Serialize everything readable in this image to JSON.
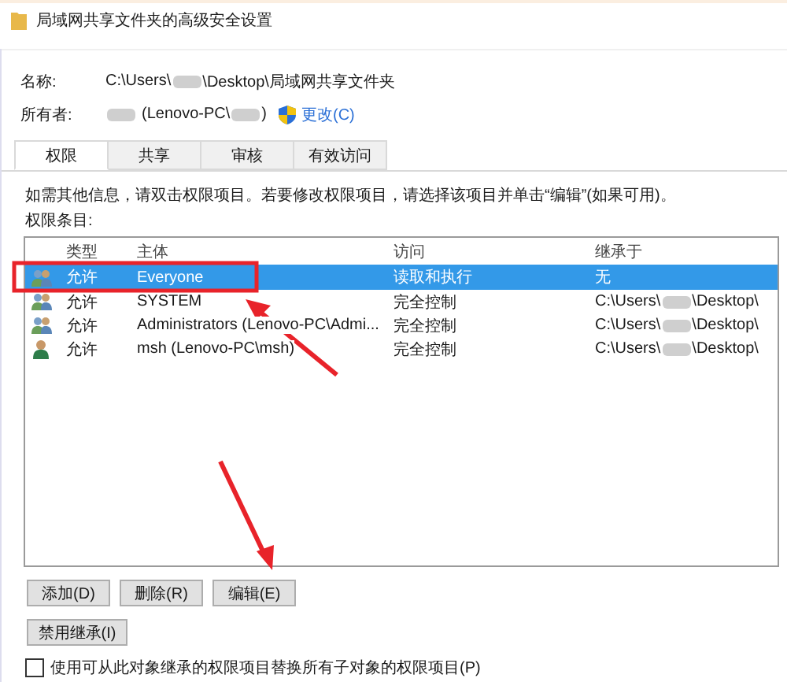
{
  "window": {
    "title": "局域网共享文件夹的高级安全设置"
  },
  "name_field": {
    "label": "名称:",
    "path_before": "C:\\Users\\",
    "path_after": "\\Desktop\\局域网共享文件夹"
  },
  "owner_field": {
    "label": "所有者:",
    "value_before": "(Lenovo-PC\\",
    "value_after": ")",
    "change_link": "更改(C)"
  },
  "tabs": [
    {
      "label": "权限",
      "selected": true
    },
    {
      "label": "共享",
      "selected": false
    },
    {
      "label": "审核",
      "selected": false
    },
    {
      "label": "有效访问",
      "selected": false
    }
  ],
  "info_text": "如需其他信息，请双击权限项目。若要修改权限项目，请选择该项目并单击“编辑”(如果可用)。",
  "entries_label": "权限条目:",
  "table": {
    "columns": [
      "类型",
      "主体",
      "访问",
      "继承于"
    ],
    "rows": [
      {
        "kind": "group",
        "type": "允许",
        "principal": "Everyone",
        "access": "读取和执行",
        "inherited_before": "无",
        "selected": true
      },
      {
        "kind": "group",
        "type": "允许",
        "principal": "SYSTEM",
        "access": "完全控制",
        "inherited_before": "C:\\Users\\",
        "inherited_after": "\\Desktop\\",
        "selected": false
      },
      {
        "kind": "group",
        "type": "允许",
        "principal": "Administrators (Lenovo-PC\\Admi...",
        "access": "完全控制",
        "inherited_before": "C:\\Users\\",
        "inherited_after": "\\Desktop\\",
        "selected": false
      },
      {
        "kind": "user",
        "type": "允许",
        "principal": "msh (Lenovo-PC\\msh)",
        "access": "完全控制",
        "inherited_before": "C:\\Users\\",
        "inherited_after": "\\Desktop\\",
        "selected": false
      }
    ]
  },
  "buttons": [
    "添加(D)",
    "删除(R)",
    "编辑(E)"
  ],
  "inherit_button": "禁用继承(I)",
  "replace_checkbox": {
    "label": "使用可从此对象继承的权限项目替换所有子对象的权限项目(P)",
    "checked": false
  }
}
